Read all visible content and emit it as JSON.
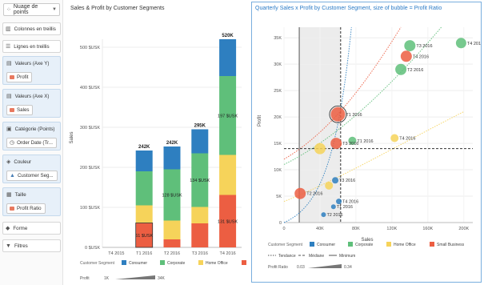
{
  "panel": {
    "chart_type": "Nuage de points",
    "trellis_columns": "Colonnes en treillis",
    "trellis_rows": "Lignes en treillis",
    "y_axis": {
      "label": "Valeurs (Axe Y)",
      "chip": "Profit"
    },
    "x_axis": {
      "label": "Valeurs (Axe X)",
      "chip": "Sales"
    },
    "category": {
      "label": "Catégorie (Points)",
      "chip": "Order Date (Tr..."
    },
    "color": {
      "label": "Couleur",
      "chip": "Customer Seg..."
    },
    "size": {
      "label": "Taille",
      "chip": "Profit Ratio"
    },
    "shape": "Forme",
    "filters": "Filtres"
  },
  "colors": {
    "accent": "#2b7bc6",
    "consumer": "#2e7fc0",
    "corporate": "#5fbf7a",
    "home_office": "#f6d35a",
    "small_business": "#ec5e42"
  },
  "chart_data": [
    {
      "type": "bar",
      "title": "Sales & Profit by Customer Segments",
      "ylabel": "Sales",
      "y_ticks": [
        "0 $USK",
        "100 $USK",
        "200 $USK",
        "300 $USK",
        "400 $USK",
        "500 $USK"
      ],
      "ylim": [
        0,
        520
      ],
      "categories": [
        "T4 2015",
        "T1 2016",
        "T2 2016",
        "T3 2016",
        "T4 2016"
      ],
      "series": [
        {
          "name": "Small Business",
          "values": [
            0,
            61,
            20,
            60,
            131
          ]
        },
        {
          "name": "Home Office",
          "values": [
            0,
            44,
            47,
            41,
            100
          ]
        },
        {
          "name": "Corporate",
          "values": [
            0,
            85,
            128,
            134,
            197
          ]
        },
        {
          "name": "Consumer",
          "values": [
            0,
            52,
            57,
            60,
            92
          ]
        }
      ],
      "segment_labels": [
        {
          "category": "T1 2016",
          "series": "Small Business",
          "text": "61 $USK"
        },
        {
          "category": "T2 2016",
          "series": "Corporate",
          "text": "128 $USK"
        },
        {
          "category": "T3 2016",
          "series": "Corporate",
          "text": "134 $USK"
        },
        {
          "category": "T4 2016",
          "series": "Corporate",
          "text": "197 $USK"
        },
        {
          "category": "T4 2016",
          "series": "Small Business",
          "text": "131 $USK"
        }
      ],
      "totals": [
        "",
        "242K",
        "242K",
        "295K",
        "520K"
      ],
      "legend": {
        "title": "Customer Segment",
        "items": [
          "Consumer",
          "Corporate",
          "Home Office",
          "Small Business"
        ]
      },
      "size_legend": {
        "label": "Profit",
        "min": "1K",
        "max": "34K"
      }
    },
    {
      "type": "scatter",
      "title": "Quarterly Sales x Profit by Customer Segment, size of bubble = Profit Ratio",
      "xlabel": "Sales",
      "ylabel": "Profit",
      "xlim": [
        0,
        210
      ],
      "ylim": [
        0,
        37
      ],
      "x_ticks": [
        "0",
        "40K",
        "80K",
        "120K",
        "160K",
        "200K"
      ],
      "y_ticks": [
        "0",
        "5K",
        "10K",
        "15K",
        "20K",
        "25K",
        "30K",
        "35K"
      ],
      "series": [
        {
          "name": "Consumer",
          "points": [
            {
              "x": 57,
              "y": 8,
              "r": 4,
              "label": "T3 2016"
            },
            {
              "x": 61,
              "y": 4,
              "r": 3.5,
              "label": "T4 2016"
            },
            {
              "x": 55,
              "y": 3,
              "r": 3,
              "label": "T1 2016"
            },
            {
              "x": 44,
              "y": 1.5,
              "r": 3,
              "label": "T2 2016"
            }
          ]
        },
        {
          "name": "Corporate",
          "points": [
            {
              "x": 140,
              "y": 33.5,
              "r": 7,
              "label": "T3 2016"
            },
            {
              "x": 197,
              "y": 34,
              "r": 6.5,
              "label": "T4 2016"
            },
            {
              "x": 130,
              "y": 29,
              "r": 7,
              "label": "T2 2016"
            },
            {
              "x": 76,
              "y": 15.5,
              "r": 5,
              "label": "T1 2016"
            }
          ]
        },
        {
          "name": "Home Office",
          "points": [
            {
              "x": 123,
              "y": 16,
              "r": 5,
              "label": "T4 2016"
            },
            {
              "x": 40,
              "y": 14,
              "r": 7,
              "label": ""
            },
            {
              "x": 50,
              "y": 7,
              "r": 5,
              "label": ""
            }
          ]
        },
        {
          "name": "Small Business",
          "points": [
            {
              "x": 60,
              "y": 20.5,
              "r": 9,
              "label": "T1 2016"
            },
            {
              "x": 136,
              "y": 31.5,
              "r": 7,
              "label": "T4 2016"
            },
            {
              "x": 58,
              "y": 15,
              "r": 7,
              "label": "T3 2016"
            },
            {
              "x": 18,
              "y": 5.5,
              "r": 7,
              "label": "T2 2016"
            }
          ]
        }
      ],
      "median": {
        "x": 63,
        "y": 14
      },
      "minimum_x": 17,
      "reference_legend": [
        "Tendance",
        "Médiane",
        "Minimum"
      ],
      "legend": {
        "title": "Customer Segment",
        "items": [
          "Consumer",
          "Corporate",
          "Home Office",
          "Small Business"
        ]
      },
      "size_legend": {
        "label": "Profit Ratio",
        "min": "0.03",
        "max": "0.34"
      }
    }
  ]
}
